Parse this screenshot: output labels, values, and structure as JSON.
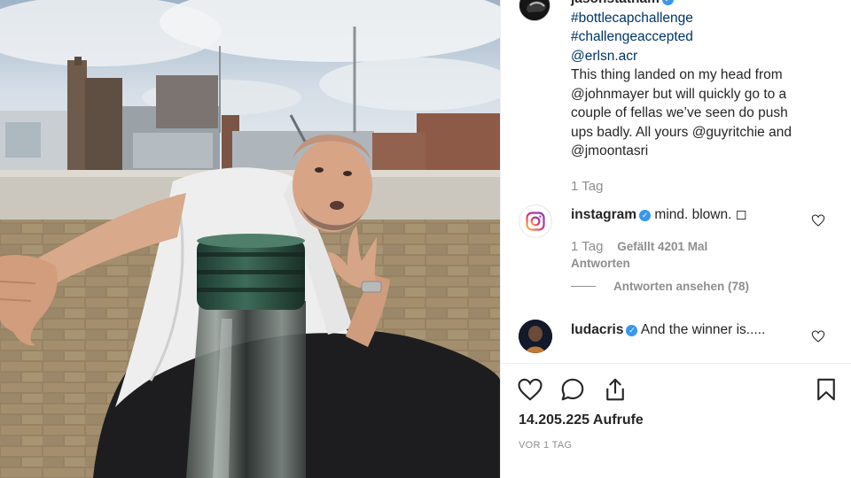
{
  "post": {
    "author": "jasonstatham",
    "caption_lines": [
      "#bottlecapchallenge",
      "#challengeaccepted",
      "@erlsn.acr"
    ],
    "caption_body": [
      "This thing landed on my head from",
      "@johnmayer but will quickly go to a",
      "couple of fellas we’ve seen do push",
      "ups badly. All yours @guyritchie and",
      "@jmoontasri"
    ],
    "time": "1 Tag"
  },
  "comments": [
    {
      "user": "instagram",
      "text": "mind. blown. ◻",
      "time": "1 Tag",
      "likes": "Gefällt 4201 Mal",
      "reply": "Antworten",
      "view_replies": "Antworten ansehen (78)"
    },
    {
      "user": "ludacris",
      "text": "And the winner is....."
    }
  ],
  "actions": {
    "views": "14.205.225 Aufrufe",
    "posted": "VOR 1 TAG"
  },
  "icons": [
    "verified-icon",
    "heart-icon",
    "comment-icon",
    "share-icon",
    "bookmark-icon"
  ],
  "colors": {
    "link": "#003569",
    "verified": "#3897f0",
    "muted": "#8e8e8e"
  }
}
